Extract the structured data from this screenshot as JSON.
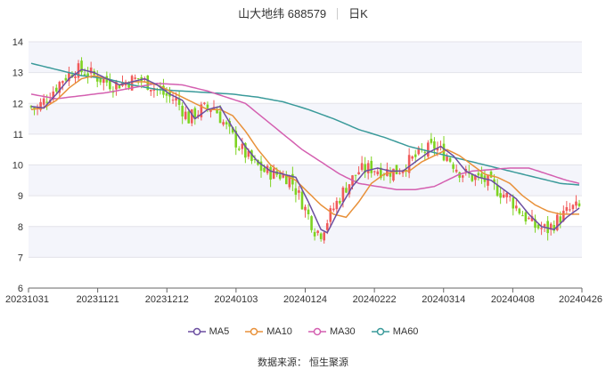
{
  "header": {
    "stock": "山大地纬 688579",
    "period": "日K"
  },
  "source_text": "数据来源：  恒生聚源",
  "chart_data": {
    "type": "candlestick",
    "y_ticks": [
      "6",
      "7",
      "8",
      "9",
      "10",
      "11",
      "12",
      "13",
      "14"
    ],
    "ylim": [
      6,
      14
    ],
    "x_tick_labels": [
      "20231031",
      "20231121",
      "20231212",
      "20240103",
      "20240124",
      "20240222",
      "20240314",
      "20240408",
      "20240426"
    ],
    "grid": true,
    "colors": {
      "up": "#f05a5a",
      "down": "#7ed321",
      "MA5": "#6b4ea0",
      "MA10": "#e8913a",
      "MA30": "#d45fb0",
      "MA60": "#3a9a9a"
    },
    "legend": [
      "MA5",
      "MA10",
      "MA30",
      "MA60"
    ],
    "ma_series": {
      "MA5": [
        [
          0,
          11.9
        ],
        [
          4,
          11.85
        ],
        [
          8,
          12.3
        ],
        [
          12,
          12.8
        ],
        [
          16,
          13.1
        ],
        [
          20,
          13.0
        ],
        [
          24,
          12.8
        ],
        [
          28,
          12.6
        ],
        [
          32,
          12.7
        ],
        [
          36,
          12.8
        ],
        [
          40,
          12.6
        ],
        [
          44,
          12.3
        ],
        [
          48,
          12.1
        ],
        [
          52,
          11.5
        ],
        [
          56,
          11.8
        ],
        [
          60,
          11.9
        ],
        [
          64,
          11.2
        ],
        [
          68,
          10.6
        ],
        [
          72,
          10.1
        ],
        [
          76,
          9.8
        ],
        [
          80,
          9.7
        ],
        [
          84,
          9.6
        ],
        [
          88,
          8.8
        ],
        [
          92,
          7.9
        ],
        [
          94,
          7.8
        ],
        [
          98,
          8.6
        ],
        [
          102,
          9.3
        ],
        [
          106,
          9.8
        ],
        [
          110,
          9.9
        ],
        [
          114,
          9.8
        ],
        [
          118,
          9.8
        ],
        [
          122,
          10.1
        ],
        [
          126,
          10.4
        ],
        [
          130,
          10.6
        ],
        [
          134,
          10.3
        ],
        [
          138,
          9.8
        ],
        [
          142,
          9.6
        ],
        [
          146,
          9.5
        ],
        [
          150,
          9.2
        ],
        [
          154,
          8.9
        ],
        [
          158,
          8.4
        ],
        [
          162,
          8.0
        ],
        [
          166,
          7.9
        ],
        [
          170,
          8.3
        ],
        [
          174,
          8.6
        ]
      ],
      "MA10": [
        [
          0,
          11.8
        ],
        [
          4,
          11.85
        ],
        [
          8,
          12.1
        ],
        [
          12,
          12.5
        ],
        [
          16,
          12.8
        ],
        [
          20,
          12.9
        ],
        [
          24,
          12.8
        ],
        [
          28,
          12.6
        ],
        [
          32,
          12.7
        ],
        [
          36,
          12.7
        ],
        [
          40,
          12.6
        ],
        [
          44,
          12.4
        ],
        [
          48,
          12.2
        ],
        [
          52,
          12.0
        ],
        [
          56,
          11.8
        ],
        [
          60,
          11.8
        ],
        [
          64,
          11.6
        ],
        [
          68,
          11.1
        ],
        [
          72,
          10.5
        ],
        [
          76,
          10.0
        ],
        [
          80,
          9.7
        ],
        [
          84,
          9.5
        ],
        [
          88,
          9.1
        ],
        [
          92,
          8.7
        ],
        [
          96,
          8.4
        ],
        [
          100,
          8.3
        ],
        [
          104,
          8.8
        ],
        [
          108,
          9.4
        ],
        [
          112,
          9.7
        ],
        [
          116,
          9.8
        ],
        [
          120,
          9.8
        ],
        [
          124,
          10.1
        ],
        [
          128,
          10.3
        ],
        [
          132,
          10.5
        ],
        [
          136,
          10.3
        ],
        [
          140,
          10.0
        ],
        [
          144,
          9.7
        ],
        [
          148,
          9.6
        ],
        [
          152,
          9.4
        ],
        [
          156,
          9.0
        ],
        [
          160,
          8.7
        ],
        [
          164,
          8.5
        ],
        [
          168,
          8.4
        ],
        [
          174,
          8.4
        ]
      ],
      "MA30": [
        [
          0,
          12.3
        ],
        [
          8,
          12.15
        ],
        [
          16,
          12.25
        ],
        [
          24,
          12.35
        ],
        [
          32,
          12.5
        ],
        [
          40,
          12.65
        ],
        [
          48,
          12.6
        ],
        [
          56,
          12.4
        ],
        [
          62,
          12.2
        ],
        [
          68,
          12.0
        ],
        [
          74,
          11.5
        ],
        [
          80,
          11.0
        ],
        [
          86,
          10.5
        ],
        [
          92,
          10.1
        ],
        [
          98,
          9.7
        ],
        [
          104,
          9.4
        ],
        [
          110,
          9.3
        ],
        [
          116,
          9.2
        ],
        [
          122,
          9.2
        ],
        [
          128,
          9.3
        ],
        [
          132,
          9.5
        ],
        [
          136,
          9.7
        ],
        [
          140,
          9.8
        ],
        [
          146,
          9.85
        ],
        [
          152,
          9.9
        ],
        [
          158,
          9.9
        ],
        [
          164,
          9.7
        ],
        [
          170,
          9.5
        ],
        [
          174,
          9.4
        ]
      ],
      "MA60": [
        [
          0,
          13.3
        ],
        [
          8,
          13.1
        ],
        [
          16,
          12.9
        ],
        [
          24,
          12.8
        ],
        [
          32,
          12.6
        ],
        [
          40,
          12.45
        ],
        [
          48,
          12.4
        ],
        [
          56,
          12.35
        ],
        [
          64,
          12.3
        ],
        [
          72,
          12.2
        ],
        [
          80,
          12.05
        ],
        [
          88,
          11.8
        ],
        [
          96,
          11.5
        ],
        [
          104,
          11.15
        ],
        [
          112,
          10.9
        ],
        [
          120,
          10.6
        ],
        [
          128,
          10.4
        ],
        [
          136,
          10.2
        ],
        [
          144,
          10.0
        ],
        [
          152,
          9.8
        ],
        [
          160,
          9.6
        ],
        [
          168,
          9.4
        ],
        [
          174,
          9.35
        ]
      ]
    }
  }
}
